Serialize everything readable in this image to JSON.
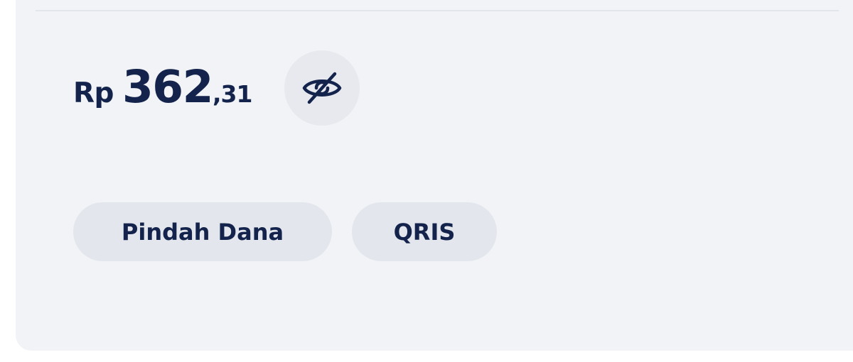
{
  "balance": {
    "currency": "Rp",
    "whole": "362",
    "fraction": ",31"
  },
  "visibility_toggle": {
    "icon": "eye-off-icon"
  },
  "actions": [
    {
      "label": "Pindah Dana"
    },
    {
      "label": "QRIS"
    }
  ],
  "colors": {
    "card_background": "#f1f3f6",
    "pill_background": "#e3e7ed",
    "text": "#13234b"
  }
}
